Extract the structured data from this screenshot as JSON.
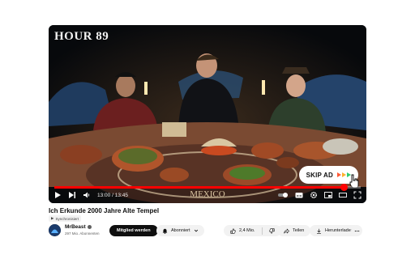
{
  "video": {
    "overlay_text": "HOUR 89",
    "skip_ad_label": "SKIP AD",
    "time_current": "13:00",
    "time_total": "13:45",
    "progress": 0.945,
    "tablecloth_text": "MEXICO",
    "accent_color": "#ff0000"
  },
  "meta": {
    "title": "Ich Erkunde 2000 Jahre Alte Tempel",
    "sync_badge": "Synchronisiert",
    "channel": {
      "name": "MrBeast",
      "subscribers": "297 Mio. Abonnenten"
    },
    "join_button": "Mitglied werden",
    "subscribe_button": "Abonniert",
    "likes": "2,4 Mio.",
    "share_button": "Teilen",
    "download_button": "Herunterladen"
  },
  "icons": [
    "play-icon",
    "next-icon",
    "volume-icon",
    "autoplay-toggle",
    "subtitles-icon",
    "settings-icon",
    "miniplayer-icon",
    "theater-icon",
    "fullscreen-icon",
    "like-icon",
    "dislike-icon",
    "share-icon",
    "download-icon",
    "more-icon",
    "bell-icon",
    "chevron-down-icon"
  ]
}
